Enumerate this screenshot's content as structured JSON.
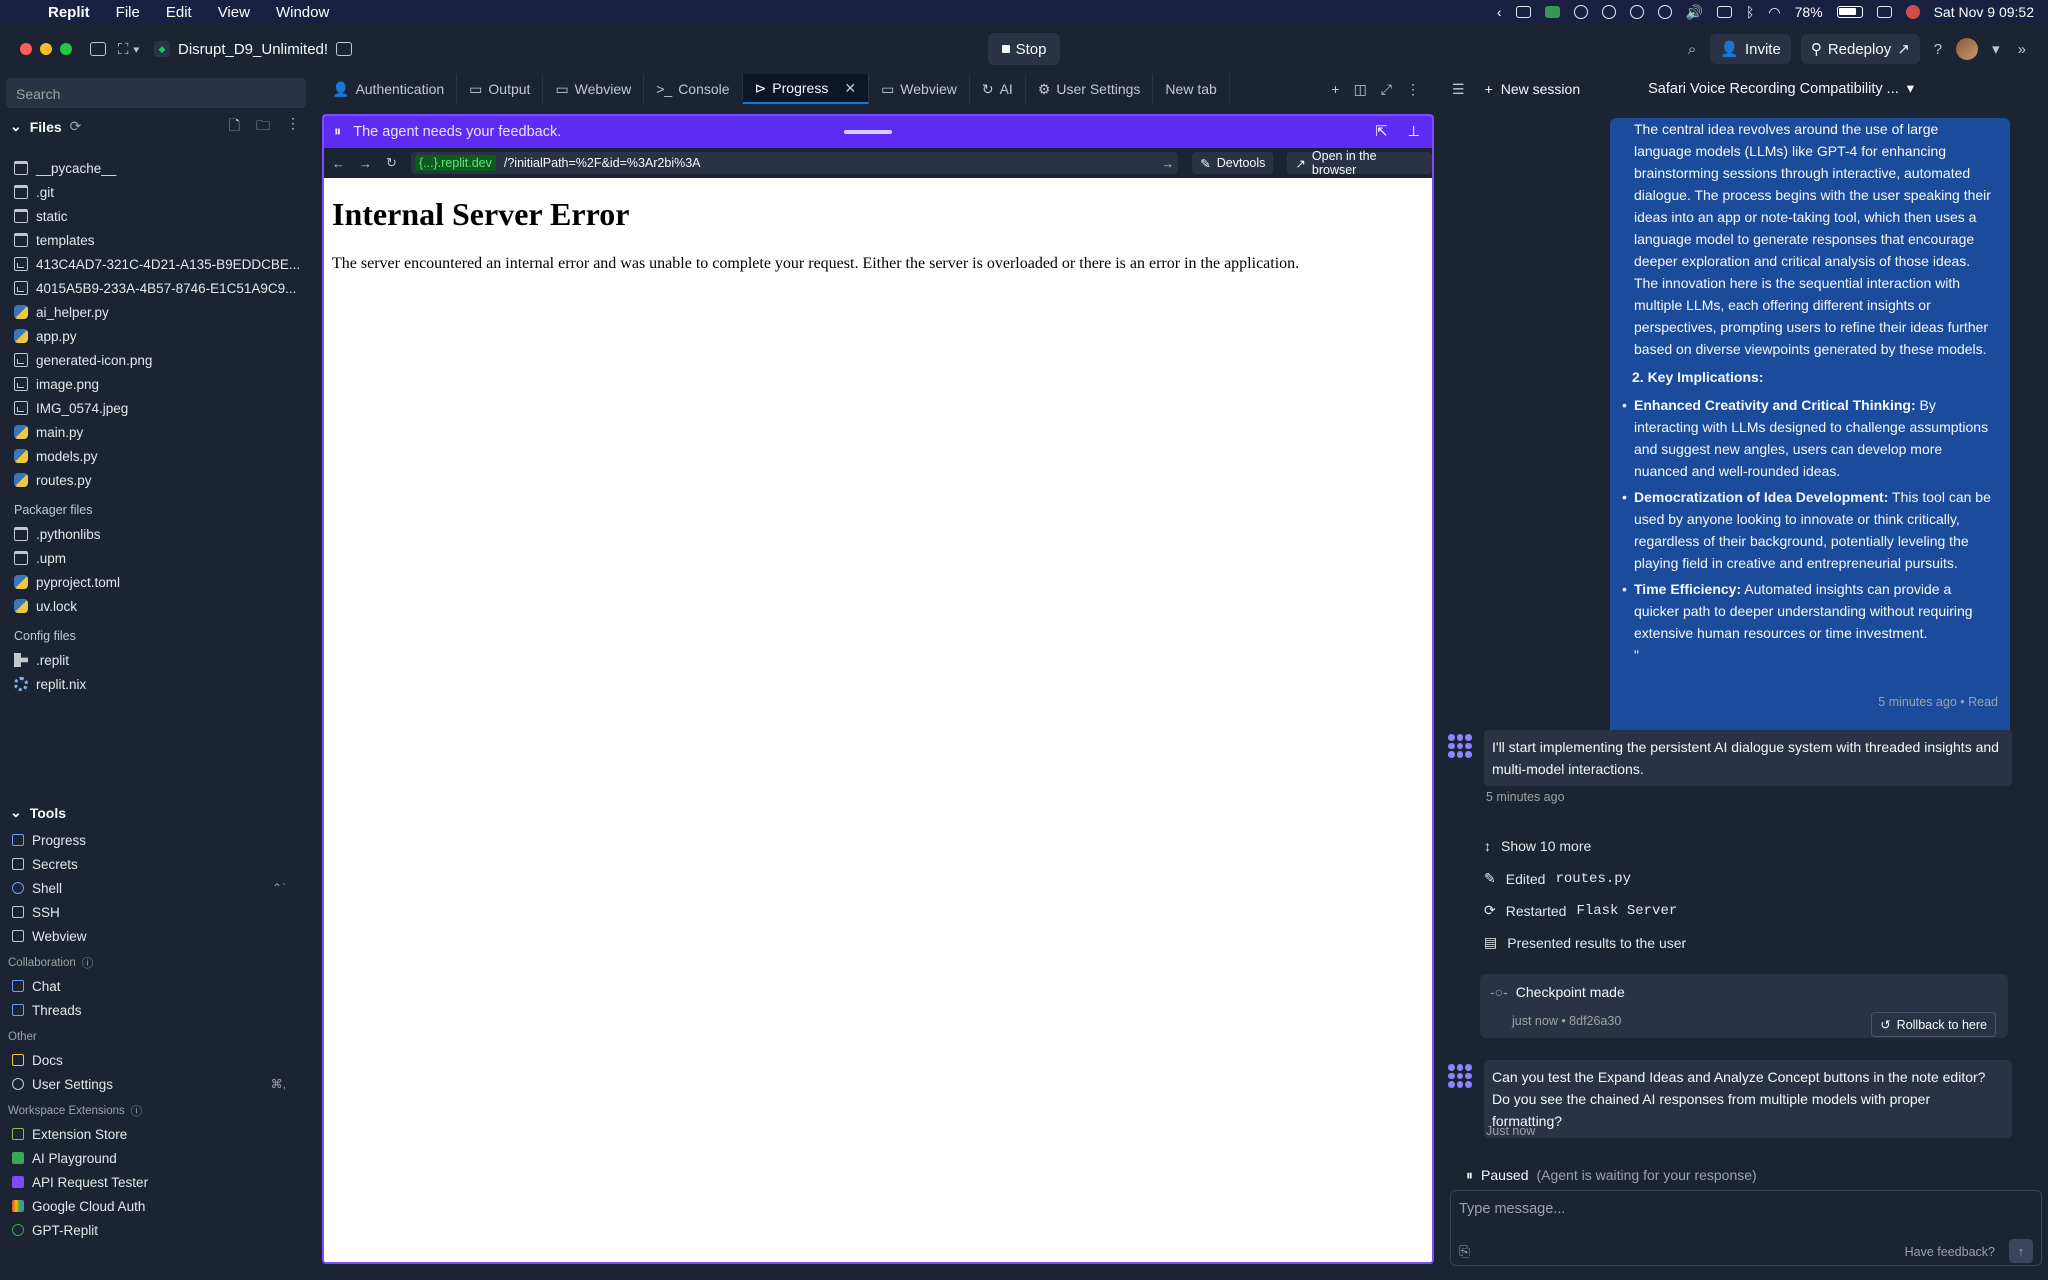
{
  "menubar": {
    "app": "Replit",
    "menus": [
      "File",
      "Edit",
      "View",
      "Window"
    ],
    "battery": "78%",
    "datetime": "Sat Nov 9  09:52"
  },
  "topbar": {
    "repl_name": "Disrupt_D9_Unlimited!",
    "stop_label": "Stop",
    "invite_label": "Invite",
    "redeploy_label": "Redeploy"
  },
  "sidebar": {
    "search_placeholder": "Search",
    "files_title": "Files",
    "files": [
      {
        "name": "__pycache__",
        "type": "folder"
      },
      {
        "name": ".git",
        "type": "folder"
      },
      {
        "name": "static",
        "type": "folder"
      },
      {
        "name": "templates",
        "type": "folder"
      },
      {
        "name": "413C4AD7-321C-4D21-A135-B9EDDCBE...",
        "type": "image"
      },
      {
        "name": "4015A5B9-233A-4B57-8746-E1C51A9C9...",
        "type": "image"
      },
      {
        "name": "ai_helper.py",
        "type": "py"
      },
      {
        "name": "app.py",
        "type": "py"
      },
      {
        "name": "generated-icon.png",
        "type": "image"
      },
      {
        "name": "image.png",
        "type": "image"
      },
      {
        "name": "IMG_0574.jpeg",
        "type": "image"
      },
      {
        "name": "main.py",
        "type": "py"
      },
      {
        "name": "models.py",
        "type": "py"
      },
      {
        "name": "routes.py",
        "type": "py"
      }
    ],
    "packager_label": "Packager files",
    "packager_files": [
      {
        "name": ".pythonlibs",
        "type": "folder"
      },
      {
        "name": ".upm",
        "type": "folder"
      },
      {
        "name": "pyproject.toml",
        "type": "py"
      },
      {
        "name": "uv.lock",
        "type": "py"
      }
    ],
    "config_label": "Config files",
    "config_files": [
      {
        "name": ".replit",
        "type": "replit"
      },
      {
        "name": "replit.nix",
        "type": "nix"
      }
    ],
    "tools_title": "Tools",
    "tools": [
      "Progress",
      "Secrets",
      "Shell",
      "SSH",
      "Webview"
    ],
    "collab_label": "Collaboration",
    "collab": [
      "Chat",
      "Threads"
    ],
    "other_label": "Other",
    "other": [
      "Docs",
      "User Settings"
    ],
    "user_settings_kbd": "⌘,",
    "ext_label": "Workspace Extensions",
    "extensions": [
      "Extension Store",
      "AI Playground",
      "API Request Tester",
      "Google Cloud Auth",
      "GPT-Replit"
    ]
  },
  "tabs": [
    "Authentication",
    "Output",
    "Webview",
    "Console",
    "Progress",
    "Webview",
    "AI",
    "User Settings",
    "New tab"
  ],
  "webview": {
    "banner": "The agent needs your feedback.",
    "url_host": "{...}.replit.dev",
    "url_path": "/?initialPath=%2F&id=%3Ar2bi%3A",
    "devtools_label": "Devtools",
    "open_browser_label": "Open in the browser",
    "error_title": "Internal Server Error",
    "error_body": "The server encountered an internal error and was unable to complete your request. Either the server is overloaded or there is an error in the application."
  },
  "chat": {
    "new_session": "New session",
    "session_title": "Safari Voice Recording Compatibility ...",
    "user_msg_intro": "The central idea revolves around the use of large language models (LLMs) like GPT-4 for enhancing brainstorming sessions through interactive, automated dialogue. The process begins with the user speaking their ideas into an app or note-taking tool, which then uses a language model to generate responses that encourage deeper exploration and critical analysis of those ideas. The innovation here is the sequential interaction with multiple LLMs, each offering different insights or perspectives, prompting users to refine their ideas further based on diverse viewpoints generated by these models.",
    "key_heading": "2. Key Implications:",
    "bullets": [
      {
        "title": "Enhanced Creativity and Critical Thinking:",
        "text": " By interacting with LLMs designed to challenge assumptions and suggest new angles, users can develop more nuanced and well-rounded ideas."
      },
      {
        "title": "Democratization of Idea Development:",
        "text": " This tool can be used by anyone looking to innovate or think critically, regardless of their background, potentially leveling the playing field in creative and entrepreneurial pursuits."
      },
      {
        "title": "Time Efficiency:",
        "text": " Automated insights can provide a quicker path to deeper understanding without requiring extensive human resources or time investment."
      }
    ],
    "quote_close": "\"",
    "user_meta": "5 minutes ago • Read",
    "agent_msg1": "I'll start implementing the persistent AI dialogue system with threaded insights and multi-model interactions.",
    "agent_msg1_meta": "5 minutes ago",
    "show_more": "Show 10 more",
    "edited_label": "Edited",
    "edited_file": "routes.py",
    "restarted_label": "Restarted",
    "restarted_name": "Flask Server",
    "presented": "Presented results to the user",
    "checkpoint_title": "Checkpoint made",
    "checkpoint_meta": "just now • 8df26a30",
    "rollback_label": "Rollback to here",
    "agent_msg2": "Can you test the Expand Ideas and Analyze Concept buttons in the note editor? Do you see the chained AI responses from multiple models with proper formatting?",
    "agent_msg2_meta": "Just now",
    "paused_label": "Paused",
    "paused_note": "(Agent is waiting for your response)",
    "input_placeholder": "Type message...",
    "feedback_label": "Have feedback?"
  }
}
